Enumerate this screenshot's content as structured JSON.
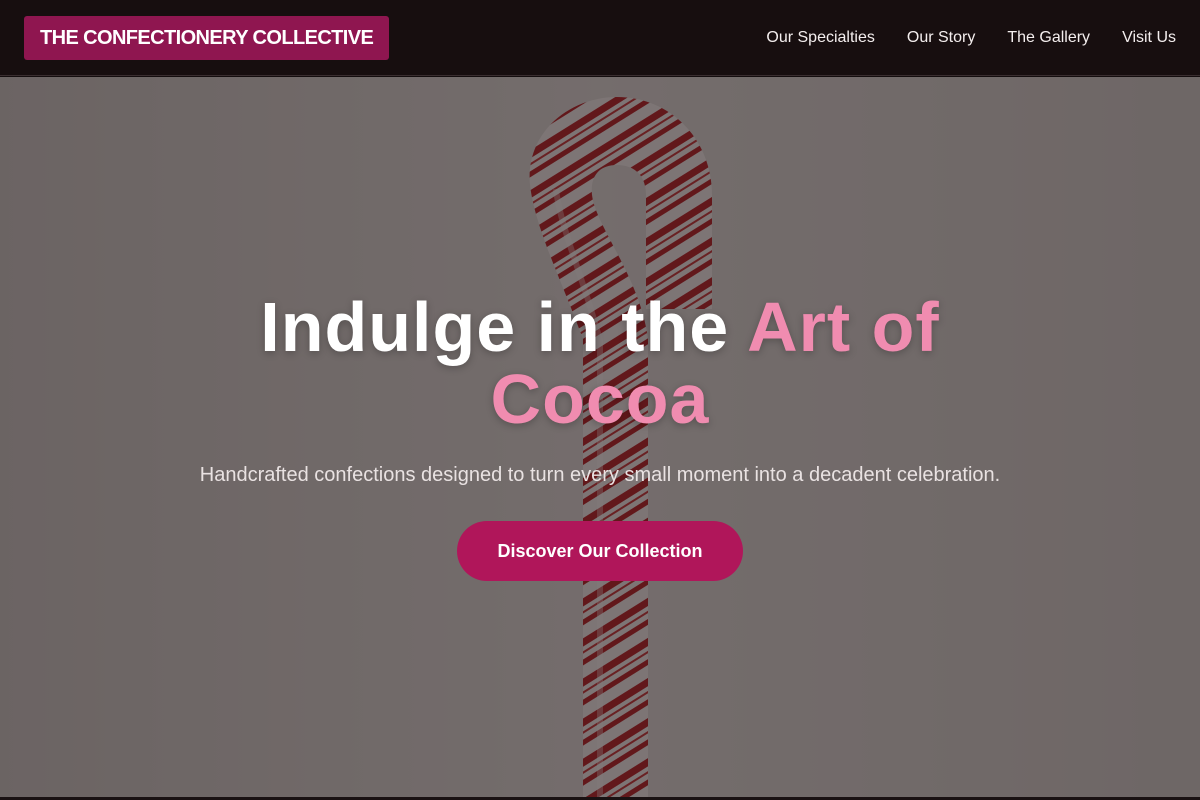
{
  "header": {
    "brand": "THE CONFECTIONERY COLLECTIVE",
    "nav": [
      {
        "label": "Our Specialties"
      },
      {
        "label": "Our Story"
      },
      {
        "label": "The Gallery"
      },
      {
        "label": "Visit Us"
      }
    ]
  },
  "hero": {
    "title_main": "Indulge in the",
    "title_accent": "Art of Cocoa",
    "subtitle": "Handcrafted confections designed to turn every small moment into a decadent celebration.",
    "cta_label": "Discover Our Collection",
    "image_subject": "candy-cane"
  },
  "colors": {
    "header_bg": "#170e0f",
    "brand_bg": "#8f1650",
    "accent_pink": "#f08cb0",
    "cta_bg": "#b0165a"
  }
}
